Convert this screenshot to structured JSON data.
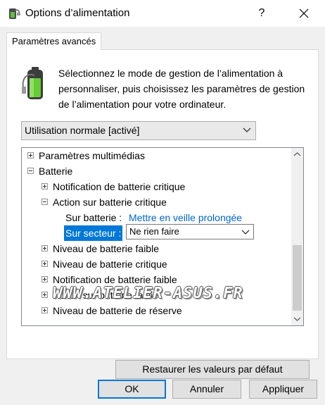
{
  "window": {
    "title": "Options d’alimentation",
    "help_label": "?",
    "close_label": "✕"
  },
  "tab": {
    "label": "Paramètres avancés"
  },
  "intro_text": "Sélectionnez le mode de gestion de l’alimentation à personnaliser, puis choisissez les paramètres de gestion de l’alimentation pour votre ordinateur.",
  "plan_select": {
    "value": "Utilisation normale [activé]"
  },
  "tree": {
    "items": [
      {
        "label": "Paramètres multimédias",
        "expanded": false
      },
      {
        "label": "Batterie",
        "expanded": true
      },
      {
        "label": "Notification de batterie critique",
        "expanded": false
      },
      {
        "label": "Action sur batterie critique",
        "expanded": true
      },
      {
        "label": "Niveau de batterie faible",
        "expanded": false
      },
      {
        "label": "Niveau de batterie critique",
        "expanded": false
      },
      {
        "label": "Notification de batterie faible",
        "expanded": false
      },
      {
        "label": "Action sur batterie faible",
        "expanded": false
      },
      {
        "label": "Niveau de batterie de réserve",
        "expanded": false
      }
    ],
    "on_battery": {
      "key": "Sur batterie :",
      "value": "Mettre en veille prolongée"
    },
    "plugged_in": {
      "key": "Sur secteur :",
      "value": "Ne rien faire"
    }
  },
  "watermark": "WWW.ATELIER-ASUS.FR",
  "buttons": {
    "restore": "Restaurer les valeurs par défaut",
    "ok": "OK",
    "cancel": "Annuler",
    "apply": "Appliquer"
  },
  "colors": {
    "accent": "#0078d7",
    "link": "#0066cc",
    "dialog_bg": "#f0f0f0"
  }
}
